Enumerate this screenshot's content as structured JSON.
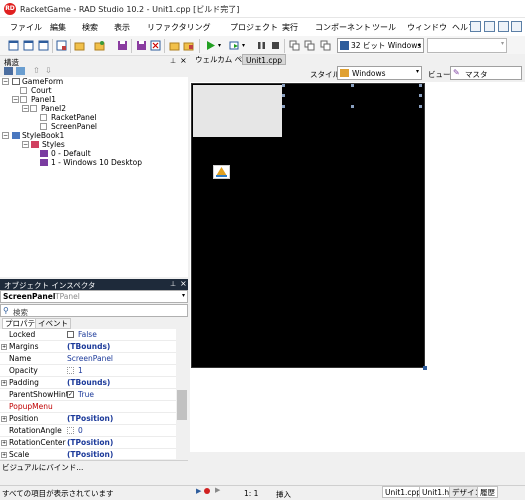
{
  "window": {
    "title": "RacketGame - RAD Studio 10.2 - Unit1.cpp [ビルド完了]",
    "app_icon_text": "RD"
  },
  "menu": {
    "items": [
      "ファイル",
      "編集",
      "検索",
      "表示",
      "リファクタリング",
      "プロジェクト",
      "実行",
      "コンポーネント",
      "ツール",
      "ウィンドウ",
      "ヘルプ"
    ]
  },
  "toolbar": {
    "platform_label": "32 ビット Windows"
  },
  "structure": {
    "title": "構造",
    "tree": [
      {
        "label": "GameForm",
        "level": 0,
        "expander": "-"
      },
      {
        "label": "Court",
        "level": 1,
        "expander": ""
      },
      {
        "label": "Panel1",
        "level": 1,
        "expander": "-"
      },
      {
        "label": "Panel2",
        "level": 2,
        "expander": "-"
      },
      {
        "label": "RacketPanel",
        "level": 3,
        "expander": ""
      },
      {
        "label": "ScreenPanel",
        "level": 3,
        "expander": ""
      },
      {
        "label": "StyleBook1",
        "level": 0,
        "expander": "-"
      },
      {
        "label": "Styles",
        "level": 1,
        "expander": "-"
      },
      {
        "label": "0 - Default",
        "level": 2,
        "expander": ""
      },
      {
        "label": "1 - Windows 10 Desktop",
        "level": 2,
        "expander": ""
      }
    ]
  },
  "inspector": {
    "title": "オブジェクト インスペクタ",
    "selected_name": "ScreenPanel",
    "selected_type": "TPanel",
    "search_placeholder": "検索",
    "tab_properties": "プロパティ",
    "tab_events": "イベント",
    "properties": [
      {
        "name": "Locked",
        "value": "False",
        "expander": false,
        "checkbox": true,
        "highlight": false
      },
      {
        "name": "Margins",
        "value": "(TBounds)",
        "expander": true,
        "checkbox": false,
        "highlight": false
      },
      {
        "name": "Name",
        "value": "ScreenPanel",
        "expander": false,
        "checkbox": false,
        "highlight": false
      },
      {
        "name": "Opacity",
        "value": "1",
        "expander": false,
        "checkbox": false,
        "highlight": false
      },
      {
        "name": "Padding",
        "value": "(TBounds)",
        "expander": true,
        "checkbox": false,
        "highlight": false
      },
      {
        "name": "ParentShowHint",
        "value": "True",
        "expander": false,
        "checkbox": true,
        "highlight": false
      },
      {
        "name": "PopupMenu",
        "value": "",
        "expander": false,
        "checkbox": false,
        "highlight": true
      },
      {
        "name": "Position",
        "value": "(TPosition)",
        "expander": true,
        "checkbox": false,
        "highlight": false
      },
      {
        "name": "RotationAngle",
        "value": "0",
        "expander": false,
        "checkbox": false,
        "highlight": false
      },
      {
        "name": "RotationCenter",
        "value": "(TPosition)",
        "expander": true,
        "checkbox": false,
        "highlight": false
      },
      {
        "name": "Scale",
        "value": "(TPosition)",
        "expander": true,
        "checkbox": false,
        "highlight": false
      }
    ],
    "bind_text": "ビジュアルにバインド..."
  },
  "design": {
    "tab_welcome": "ウェルカム ページ",
    "tab_unit": "Unit1.cpp",
    "style_label": "スタイル:",
    "style_value": "Windows",
    "view_label": "ビュー:",
    "view_value": "マスタ"
  },
  "status": {
    "left_text": "すべての項目が表示されています",
    "position": "1:  1",
    "mode": "挿入",
    "tabs": [
      "Unit1.cpp",
      "Unit1.h",
      "デザイン",
      "履歴"
    ]
  },
  "colors": {
    "form_background": "#000000",
    "inspector_header": "#1e2a3a",
    "accent_blue": "#1c3a9a",
    "highlight_red": "#c00000"
  }
}
